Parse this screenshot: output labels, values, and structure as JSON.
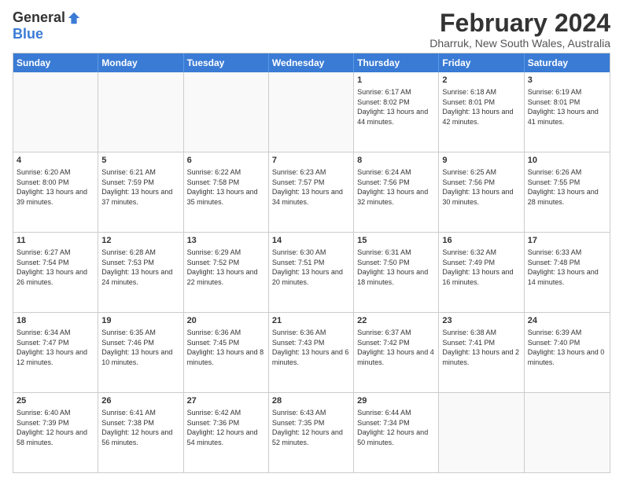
{
  "logo": {
    "general": "General",
    "blue": "Blue"
  },
  "title": "February 2024",
  "subtitle": "Dharruk, New South Wales, Australia",
  "weekdays": [
    "Sunday",
    "Monday",
    "Tuesday",
    "Wednesday",
    "Thursday",
    "Friday",
    "Saturday"
  ],
  "weeks": [
    [
      {
        "day": "",
        "info": ""
      },
      {
        "day": "",
        "info": ""
      },
      {
        "day": "",
        "info": ""
      },
      {
        "day": "",
        "info": ""
      },
      {
        "day": "1",
        "info": "Sunrise: 6:17 AM\nSunset: 8:02 PM\nDaylight: 13 hours and 44 minutes."
      },
      {
        "day": "2",
        "info": "Sunrise: 6:18 AM\nSunset: 8:01 PM\nDaylight: 13 hours and 42 minutes."
      },
      {
        "day": "3",
        "info": "Sunrise: 6:19 AM\nSunset: 8:01 PM\nDaylight: 13 hours and 41 minutes."
      }
    ],
    [
      {
        "day": "4",
        "info": "Sunrise: 6:20 AM\nSunset: 8:00 PM\nDaylight: 13 hours and 39 minutes."
      },
      {
        "day": "5",
        "info": "Sunrise: 6:21 AM\nSunset: 7:59 PM\nDaylight: 13 hours and 37 minutes."
      },
      {
        "day": "6",
        "info": "Sunrise: 6:22 AM\nSunset: 7:58 PM\nDaylight: 13 hours and 35 minutes."
      },
      {
        "day": "7",
        "info": "Sunrise: 6:23 AM\nSunset: 7:57 PM\nDaylight: 13 hours and 34 minutes."
      },
      {
        "day": "8",
        "info": "Sunrise: 6:24 AM\nSunset: 7:56 PM\nDaylight: 13 hours and 32 minutes."
      },
      {
        "day": "9",
        "info": "Sunrise: 6:25 AM\nSunset: 7:56 PM\nDaylight: 13 hours and 30 minutes."
      },
      {
        "day": "10",
        "info": "Sunrise: 6:26 AM\nSunset: 7:55 PM\nDaylight: 13 hours and 28 minutes."
      }
    ],
    [
      {
        "day": "11",
        "info": "Sunrise: 6:27 AM\nSunset: 7:54 PM\nDaylight: 13 hours and 26 minutes."
      },
      {
        "day": "12",
        "info": "Sunrise: 6:28 AM\nSunset: 7:53 PM\nDaylight: 13 hours and 24 minutes."
      },
      {
        "day": "13",
        "info": "Sunrise: 6:29 AM\nSunset: 7:52 PM\nDaylight: 13 hours and 22 minutes."
      },
      {
        "day": "14",
        "info": "Sunrise: 6:30 AM\nSunset: 7:51 PM\nDaylight: 13 hours and 20 minutes."
      },
      {
        "day": "15",
        "info": "Sunrise: 6:31 AM\nSunset: 7:50 PM\nDaylight: 13 hours and 18 minutes."
      },
      {
        "day": "16",
        "info": "Sunrise: 6:32 AM\nSunset: 7:49 PM\nDaylight: 13 hours and 16 minutes."
      },
      {
        "day": "17",
        "info": "Sunrise: 6:33 AM\nSunset: 7:48 PM\nDaylight: 13 hours and 14 minutes."
      }
    ],
    [
      {
        "day": "18",
        "info": "Sunrise: 6:34 AM\nSunset: 7:47 PM\nDaylight: 13 hours and 12 minutes."
      },
      {
        "day": "19",
        "info": "Sunrise: 6:35 AM\nSunset: 7:46 PM\nDaylight: 13 hours and 10 minutes."
      },
      {
        "day": "20",
        "info": "Sunrise: 6:36 AM\nSunset: 7:45 PM\nDaylight: 13 hours and 8 minutes."
      },
      {
        "day": "21",
        "info": "Sunrise: 6:36 AM\nSunset: 7:43 PM\nDaylight: 13 hours and 6 minutes."
      },
      {
        "day": "22",
        "info": "Sunrise: 6:37 AM\nSunset: 7:42 PM\nDaylight: 13 hours and 4 minutes."
      },
      {
        "day": "23",
        "info": "Sunrise: 6:38 AM\nSunset: 7:41 PM\nDaylight: 13 hours and 2 minutes."
      },
      {
        "day": "24",
        "info": "Sunrise: 6:39 AM\nSunset: 7:40 PM\nDaylight: 13 hours and 0 minutes."
      }
    ],
    [
      {
        "day": "25",
        "info": "Sunrise: 6:40 AM\nSunset: 7:39 PM\nDaylight: 12 hours and 58 minutes."
      },
      {
        "day": "26",
        "info": "Sunrise: 6:41 AM\nSunset: 7:38 PM\nDaylight: 12 hours and 56 minutes."
      },
      {
        "day": "27",
        "info": "Sunrise: 6:42 AM\nSunset: 7:36 PM\nDaylight: 12 hours and 54 minutes."
      },
      {
        "day": "28",
        "info": "Sunrise: 6:43 AM\nSunset: 7:35 PM\nDaylight: 12 hours and 52 minutes."
      },
      {
        "day": "29",
        "info": "Sunrise: 6:44 AM\nSunset: 7:34 PM\nDaylight: 12 hours and 50 minutes."
      },
      {
        "day": "",
        "info": ""
      },
      {
        "day": "",
        "info": ""
      }
    ]
  ]
}
